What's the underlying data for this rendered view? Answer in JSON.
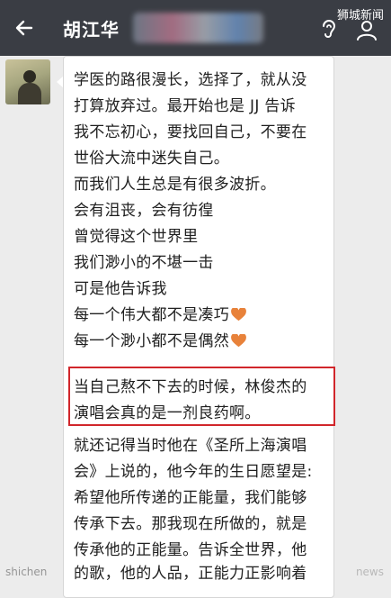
{
  "header": {
    "contact_name": "胡江华",
    "watermark": "狮城新闻"
  },
  "message": {
    "lines": [
      "学医的路很漫长，选择了，就从没",
      "打算放弃过。最开始也是 JJ 告诉",
      "我不忘初心，要找回自己，不要在",
      "世俗大流中迷失自己。",
      "而我们人生总是有很多波折。",
      "会有沮丧，会有彷徨",
      "曾觉得这个世界里",
      "我们渺小的不堪一击",
      "可是他告诉我",
      "每一个伟大都不是凑巧",
      "每一个渺小都不是偶然",
      "当自己熬不下去的时候，林俊杰的",
      "演唱会真的是一剂良药啊。",
      "就还记得当时他在《圣所上海演唱",
      "会》上说的，他今年的生日愿望是:",
      "希望他所传递的正能量，我们能够",
      "传承下去。那我现在所做的，就是",
      "传承他的正能量。告诉全世界，他",
      "的歌，他的人品，正能力正影响着"
    ],
    "heart_color": "#e8823a",
    "highlight_color": "#d1262b"
  },
  "footer": {
    "watermark_left": "shichen",
    "watermark_right": "news"
  }
}
